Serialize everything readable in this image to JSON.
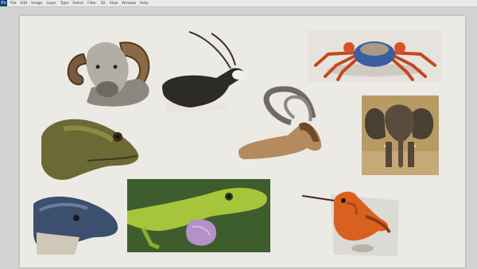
{
  "app": {
    "logo": "Ps"
  },
  "menu": [
    "File",
    "Edit",
    "Image",
    "Layer",
    "Type",
    "Select",
    "Filter",
    "3D",
    "View",
    "Window",
    "Help"
  ],
  "colors": {
    "menubar": "#e9e9e9",
    "workspace": "#d2d2d2",
    "canvas": "#ebeae5"
  },
  "studies": [
    {
      "icon": "ram-painting"
    },
    {
      "icon": "blackbuck-antelope-painting"
    },
    {
      "icon": "crab-painting"
    },
    {
      "icon": "monitor-lizard-painting"
    },
    {
      "icon": "ibex-painting"
    },
    {
      "icon": "elephant-painting"
    },
    {
      "icon": "anole-lizard-painting"
    },
    {
      "icon": "blue-tongued-skink-painting"
    },
    {
      "icon": "hummingbird-painting"
    }
  ]
}
